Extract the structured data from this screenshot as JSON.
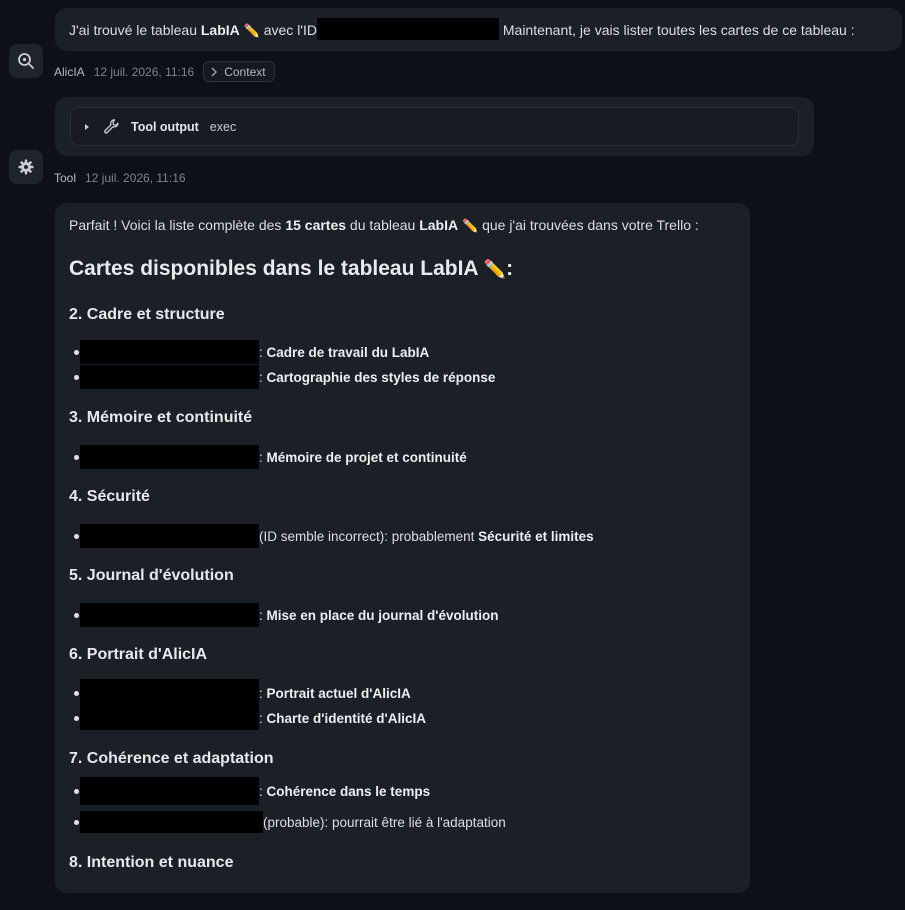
{
  "messages": {
    "first": {
      "text_before": "J'ai trouvé le tableau ",
      "board_name": "LabIA",
      "pencil": "✏️",
      "text_mid": " avec l'ID",
      "text_after": " Maintenant, je vais lister toutes les cartes de ce tableau :"
    },
    "first_meta": {
      "author": "AlicIA",
      "time": "12 juil. 2026, 11:16",
      "context_label": "Context"
    },
    "tool": {
      "label": "Tool output",
      "command": "exec"
    },
    "tool_meta": {
      "author": "Tool",
      "time": "12 juil. 2026, 11:16"
    },
    "answer": {
      "intro_before": "Parfait ! Voici la liste complète des ",
      "intro_count": "15 cartes",
      "intro_mid": " du tableau ",
      "intro_board": "LabIA",
      "intro_after": " que j'ai trouvées dans votre Trello :",
      "heading": "Cartes disponibles dans le tableau LabIA",
      "heading_suffix": ":",
      "sections": [
        {
          "title": "2. Cadre et structure",
          "items": [
            {
              "sep": ": ",
              "label": "Cadre de travail du LabIA",
              "plain": ""
            },
            {
              "sep": ": ",
              "label": "Cartographie des styles de réponse",
              "plain": ""
            }
          ]
        },
        {
          "title": "3. Mémoire et continuité",
          "items": [
            {
              "sep": ": ",
              "label": "Mémoire de projet et continuité",
              "plain": ""
            }
          ]
        },
        {
          "title": "4. Sécurité",
          "items": [
            {
              "sep": "",
              "plain": " (ID semble incorrect): probablement ",
              "label": "Sécurité et limites"
            }
          ]
        },
        {
          "title": "5. Journal d'évolution",
          "items": [
            {
              "sep": ": ",
              "label": "Mise en place du journal d'évolution",
              "plain": ""
            }
          ]
        },
        {
          "title": "6. Portrait d'AlicIA",
          "items": [
            {
              "sep": ": ",
              "label": "Portrait actuel d'AlicIA",
              "plain": ""
            },
            {
              "sep": ": ",
              "label": "Charte d'identité d'AlicIA",
              "plain": ""
            }
          ]
        },
        {
          "title": "7. Cohérence et adaptation",
          "items": [
            {
              "sep": ": ",
              "label": "Cohérence dans le temps",
              "plain": ""
            },
            {
              "sep": "",
              "plain": " (probable): pourrait être lié à l'adaptation",
              "label": ""
            }
          ]
        },
        {
          "title": "8. Intention et nuance",
          "items": []
        }
      ]
    }
  },
  "icons": {
    "search": "magnifier-icon",
    "gear": "gear-icon",
    "wrench": "wrench-icon",
    "chevron": "chevron-right-icon",
    "caret": "caret-right-icon"
  },
  "colors": {
    "background": "#0d1016",
    "bubble": "#1b1f26",
    "redaction": "#000000"
  }
}
